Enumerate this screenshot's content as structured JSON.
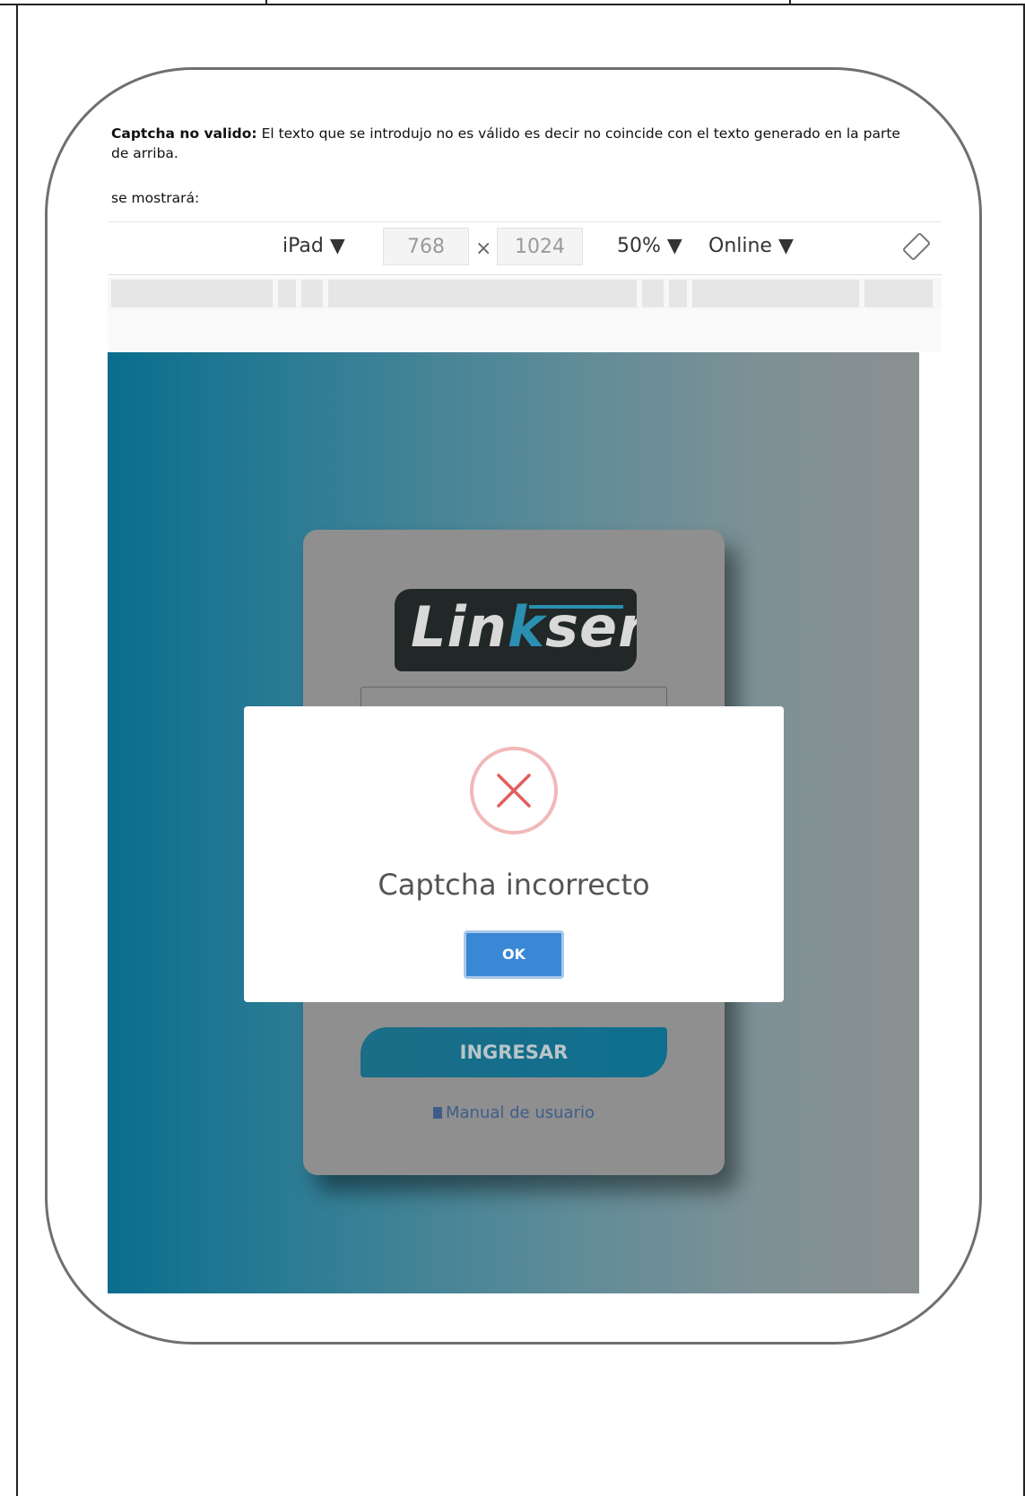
{
  "document": {
    "paragraph_bold": "Captcha no valido:",
    "paragraph_text": " El texto que se introdujo no es válido es decir no coincide con el texto generado en la parte de arriba.",
    "shown_text": "se mostrará:"
  },
  "devtools": {
    "device": "iPad ▼",
    "width": "768",
    "times": "×",
    "height": "1024",
    "zoom": "50% ▼",
    "network": "Online ▼",
    "rotate_icon": "rotate-icon"
  },
  "login": {
    "logo_prefix": "Lin",
    "logo_accent": "k",
    "logo_suffix": "ser",
    "submit_label": "INGRESAR",
    "manual_label": "Manual de usuario"
  },
  "modal": {
    "title": "Captcha incorrecto",
    "ok_label": "OK",
    "icon": "error-x-icon",
    "error_color": "#e35d5d",
    "button_color": "#3a87d6"
  }
}
